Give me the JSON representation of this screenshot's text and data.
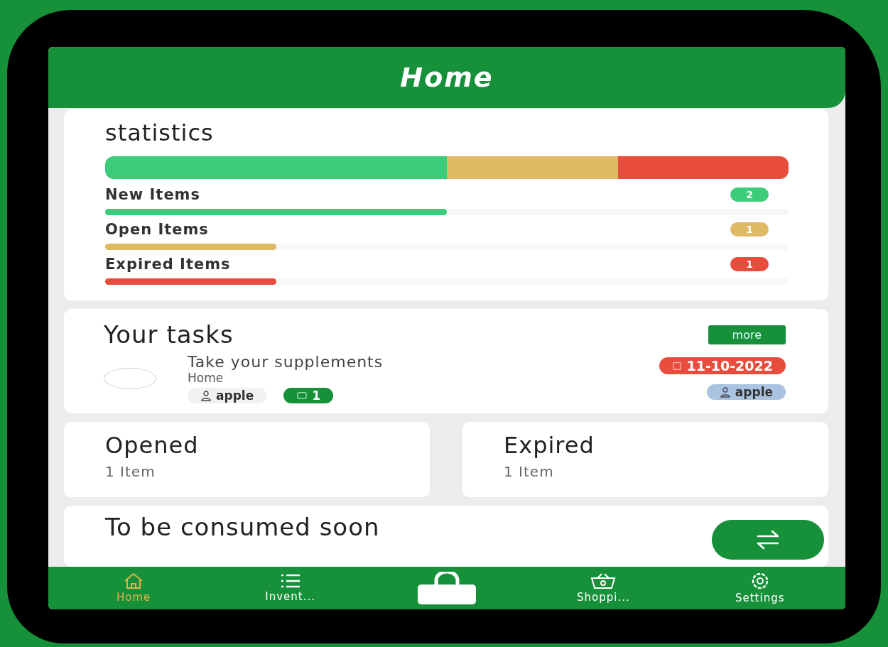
{
  "header": {
    "title": "Home"
  },
  "statistics": {
    "title": "statistics",
    "items": [
      {
        "label": "New Items",
        "count": "2",
        "level": 0.5,
        "color": "#3ccc7a"
      },
      {
        "label": "Open Items",
        "count": "1",
        "level": 0.25,
        "color": "#dfb964"
      },
      {
        "label": "Expired Items",
        "count": "1",
        "level": 0.25,
        "color": "#e84c3d"
      }
    ]
  },
  "tasks": {
    "title": "Your tasks",
    "more": "more",
    "items": [
      {
        "title": "Take your supplements",
        "location": "Home",
        "checked": false,
        "owner": "apple",
        "count": "1",
        "date": "11-10-2022",
        "assignee": "apple"
      }
    ]
  },
  "summary": [
    {
      "title": "Opened",
      "subtitle": "1 Item"
    },
    {
      "title": "Expired",
      "subtitle": "1 Item"
    }
  ],
  "soon": {
    "title": "To be consumed soon"
  },
  "nav": [
    {
      "kind": "home",
      "label": "Home",
      "selected": true
    },
    {
      "kind": "list",
      "label": "Invent...",
      "selected": false
    },
    {
      "kind": "lock"
    },
    {
      "kind": "basket",
      "label": "Shoppi...",
      "selected": false
    },
    {
      "kind": "settings",
      "label": "Settings",
      "selected": false
    }
  ]
}
